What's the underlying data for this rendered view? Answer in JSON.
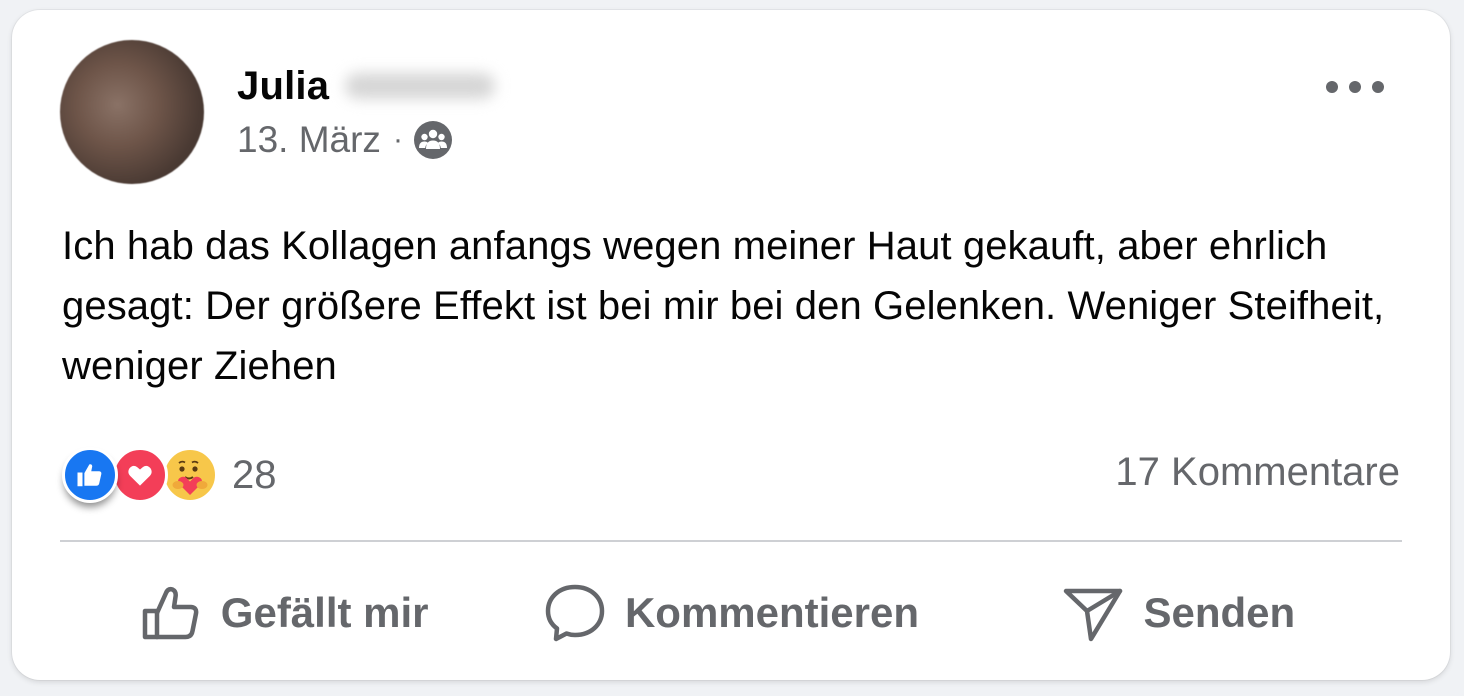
{
  "post": {
    "author": {
      "first_name": "Julia"
    },
    "date": "13. März",
    "separator": "·",
    "audience_icon": "friends-icon",
    "more_icon": "more-horizontal-icon",
    "text": "Ich hab das Kollagen anfangs wegen meiner Haut gekauft, aber ehrlich gesagt: Der größere Effekt ist bei mir bei den Gelenken. Weniger Steifheit, weniger Ziehen"
  },
  "reactions": {
    "types": [
      "like",
      "love",
      "care"
    ],
    "count": "28",
    "colors": {
      "like": "#1877f2",
      "love": "#f33e58",
      "care": "#f7c74a"
    }
  },
  "comments": {
    "label": "17 Kommentare"
  },
  "actions": {
    "like_label": "Gefällt mir",
    "comment_label": "Kommentieren",
    "send_label": "Senden",
    "like_icon": "thumbs-up-icon",
    "comment_icon": "comment-bubble-icon",
    "send_icon": "send-icon"
  },
  "colors": {
    "text_primary": "#050505",
    "text_secondary": "#65676b",
    "divider": "#ced0d4",
    "card_background": "#ffffff"
  }
}
